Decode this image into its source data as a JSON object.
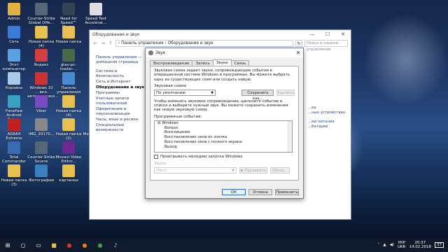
{
  "desktop": {
    "icons": [
      {
        "label": "Admin",
        "color": "#e0b040"
      },
      {
        "label": "Counter-Strike Global Offe…",
        "color": "#556677"
      },
      {
        "label": "Need for Speed™ Most…",
        "color": "#334455"
      },
      {
        "label": "Speed Test Accelerat…",
        "color": "#dddddd"
      },
      {
        "label": "Сеть",
        "color": "#3a7bd5"
      },
      {
        "label": "Новая папка (4)",
        "color": "#e8c050"
      },
      {
        "label": "Новая папка",
        "color": "#e8c050"
      },
      {
        "label": "Этот компьютер",
        "color": "#5aa0e0"
      },
      {
        "label": "Яндекс",
        "color": "#d24040"
      },
      {
        "label": "gtav-pc-loader-...",
        "color": "#4a6a4a"
      },
      {
        "label": "Корзина",
        "color": "#aac8e8"
      },
      {
        "label": "Windows 10 ... вкл. автозагрузки...",
        "color": "#cc3333"
      },
      {
        "label": "Панель управления",
        "color": "#4a8ad0"
      },
      {
        "label": "FonePaw Android Data...",
        "color": "#3aa0c0"
      },
      {
        "label": "Viber",
        "color": "#7a4ac0"
      },
      {
        "label": "Новая папка (4)",
        "color": "#e8c050"
      },
      {
        "label": "ADA64 Extreme",
        "color": "#c02020"
      },
      {
        "label": "IMG_20170...",
        "color": "#888888"
      },
      {
        "label": "Новая папка (2)",
        "color": "#e8c050"
      },
      {
        "label": "Movavi Video Edi...",
        "color": "#7a3aa0"
      },
      {
        "label": "Total Commander",
        "color": "#3a6ab0"
      },
      {
        "label": "Counter-Strike Source",
        "color": "#556677"
      },
      {
        "label": "Movavi Video Editor...",
        "color": "#6a2a90"
      },
      {
        "label": "Новая папка (3)",
        "color": "#e8c050"
      },
      {
        "label": "Фотография",
        "color": "#3a80c0"
      },
      {
        "label": "картинки",
        "color": "#e8c050"
      }
    ]
  },
  "back_window": {
    "title": "Оборудование и звук",
    "min": "—",
    "max": "☐",
    "close": "✕",
    "back_arrow": "←",
    "fwd_arrow": "→",
    "up_arrow": "↑",
    "breadcrumb": "›  Панель управления  ›  Оборудование и звук",
    "refresh": "↻",
    "search_placeholder": "Поиск в панели управления",
    "nav": {
      "home": "Панель управления — домашняя страница",
      "items": [
        "Система и безопасность",
        "Сеть и Интернет",
        "Оборудование и звук",
        "Программы",
        "Учетные записи пользователей",
        "Оформление и персонализация",
        "Часы, язык и регион",
        "Специальные возможности"
      ]
    },
    "right_links": [
      "...ва",
      "...ных устройствах",
      "...ии питания",
      "...батареи"
    ]
  },
  "dialog": {
    "title": "Звук",
    "close": "✕",
    "tabs": [
      "Воспроизведение",
      "Запись",
      "Звуки",
      "Связь"
    ],
    "desc1": "Звуковая схема задает звуки, сопровождающие события в операционной системе Windows и программах. Вы можете выбрать одну из существующих схем или создать новую.",
    "scheme_label": "Звуковая схема:",
    "scheme_value": "По умолчанию",
    "save_as": "Сохранить как...",
    "delete": "Удалить",
    "desc2": "Чтобы изменить звуковое сопровождение, щелкните событие в списке и выберите нужный звук. Вы можете сохранить изменения как новую звуковую схему.",
    "events_label": "Программные события:",
    "events": [
      "Windows",
      "Вопрос",
      "Восклицание",
      "Восстановление окна из значка",
      "Восстановление окна с полного экрана",
      "Выход"
    ],
    "startup_label": "Проигрывать мелодию запуска Windows",
    "sounds_label": "Звуки:",
    "sound_value": "(Нет)",
    "test": "▶ Проверить",
    "browse": "Обзор...",
    "ok": "ОК",
    "cancel": "Отмена",
    "apply": "Применить"
  },
  "taskbar": {
    "lang": "УКР",
    "lang2": "UKR",
    "time": "20:37",
    "date": "14.02.2018",
    "notif": "37",
    "icons": [
      "windows-icon",
      "search-icon",
      "task-view-icon",
      "explorer-icon",
      "opera-icon",
      "firefox-icon",
      "chrome-icon",
      "sound-app-icon"
    ]
  }
}
